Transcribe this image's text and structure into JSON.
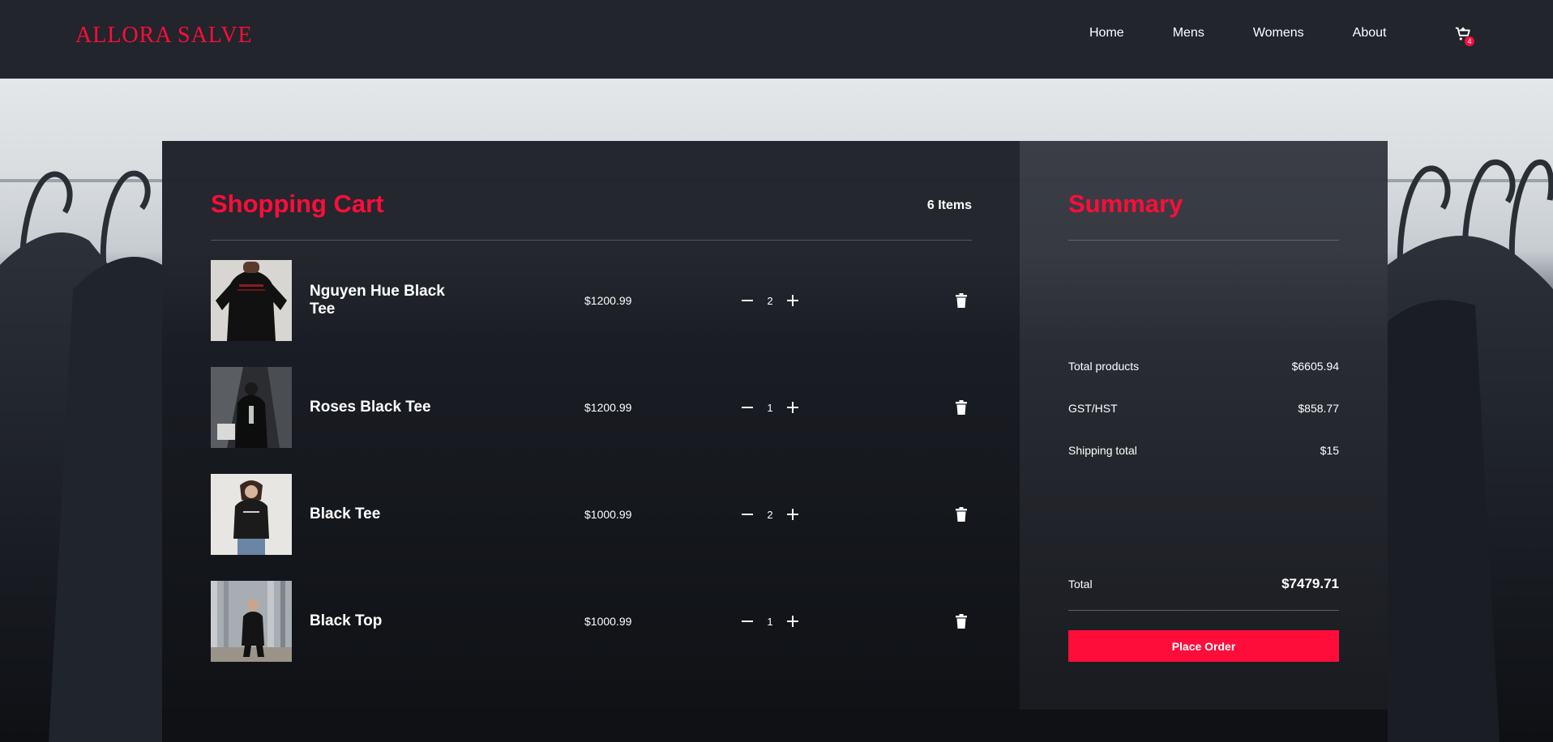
{
  "brand": "ALLORA SALVE",
  "nav": {
    "links": [
      "Home",
      "Mens",
      "Womens",
      "About"
    ],
    "cart_badge": "4"
  },
  "cart": {
    "title": "Shopping Cart",
    "count_label": "6 Items",
    "items": [
      {
        "name": "Nguyen Hue Black Tee",
        "price": "$1200.99",
        "qty": "2"
      },
      {
        "name": "Roses Black Tee",
        "price": "$1200.99",
        "qty": "1"
      },
      {
        "name": "Black Tee",
        "price": "$1000.99",
        "qty": "2"
      },
      {
        "name": "Black Top",
        "price": "$1000.99",
        "qty": "1"
      }
    ]
  },
  "summary": {
    "title": "Summary",
    "rows": [
      {
        "label": "Total products",
        "value": "$6605.94"
      },
      {
        "label": "GST/HST",
        "value": "$858.77"
      },
      {
        "label": "Shipping total",
        "value": "$15"
      }
    ],
    "total_label": "Total",
    "total_value": "$7479.71",
    "button_label": "Place Order"
  },
  "colors": {
    "accent": "#ff0d3a",
    "navbar": "#22252c",
    "cart_panel": "#1e2128",
    "summary_panel": "#34373f"
  },
  "icons": [
    "cart-icon",
    "minus-icon",
    "plus-icon",
    "trash-icon"
  ]
}
